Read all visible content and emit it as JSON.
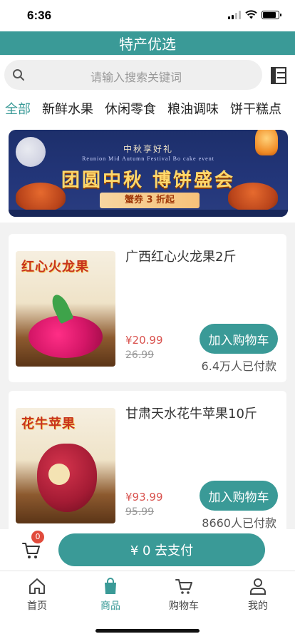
{
  "status": {
    "time": "6:36"
  },
  "header": {
    "title": "特产优选"
  },
  "search": {
    "placeholder": "请输入搜索关键词"
  },
  "tabs": [
    {
      "label": "全部",
      "active": true
    },
    {
      "label": "新鲜水果",
      "active": false
    },
    {
      "label": "休闲零食",
      "active": false
    },
    {
      "label": "粮油调味",
      "active": false
    },
    {
      "label": "饼干糕点",
      "active": false
    }
  ],
  "banner": {
    "sub_title": "中秋享好礼",
    "en_title": "Reunion Mid Autumn Festival Bo cake event",
    "main_title": "团圆中秋 博饼盛会",
    "promo": "蟹券 3 折起"
  },
  "products": [
    {
      "image_label": "红心火龙果",
      "name": "广西红心火龙果2斤",
      "price": "¥20.99",
      "original_price": "26.99",
      "add_label": "加入购物车",
      "sold": "6.4万人已付款"
    },
    {
      "image_label": "花牛苹果",
      "name": "甘肃天水花牛苹果10斤",
      "price": "¥93.99",
      "original_price": "95.99",
      "add_label": "加入购物车",
      "sold": "8660人已付款"
    }
  ],
  "pay_bar": {
    "cart_count": "0",
    "pay_label": "¥ 0 去支付"
  },
  "tab_bar": [
    {
      "label": "首页",
      "icon": "home-icon",
      "active": false
    },
    {
      "label": "商品",
      "icon": "bag-icon",
      "active": true
    },
    {
      "label": "购物车",
      "icon": "cart-icon",
      "active": false
    },
    {
      "label": "我的",
      "icon": "user-icon",
      "active": false
    }
  ],
  "colors": {
    "accent": "#3a9a97",
    "price": "#d9534f",
    "badge": "#e14b3c"
  }
}
